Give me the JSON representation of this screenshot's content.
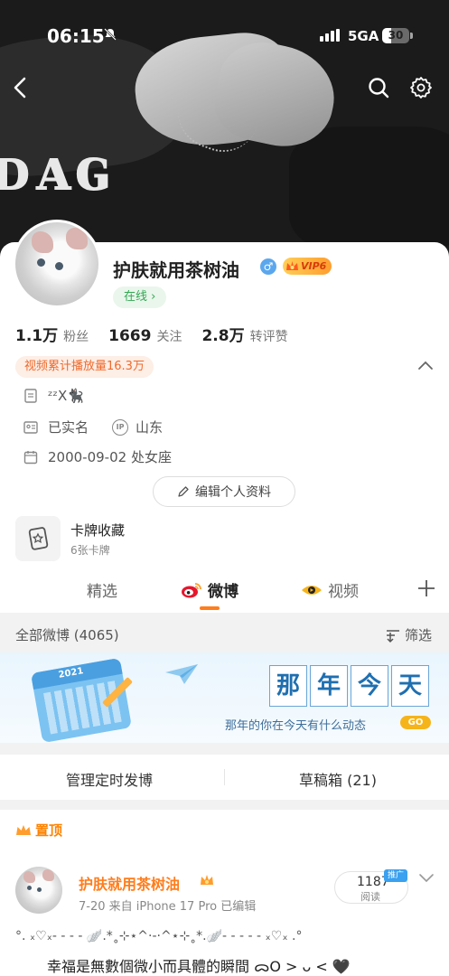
{
  "status_bar": {
    "time": "06:15",
    "network": "5GA",
    "battery": "30"
  },
  "cover": {
    "text": "ᴅᴀɢ"
  },
  "profile": {
    "username": "护肤就用茶树油",
    "gender_symbol": "♂",
    "vip_label": "VIP6",
    "online_label": "在线 ›",
    "stats": [
      {
        "value": "1.1万",
        "label": "粉丝"
      },
      {
        "value": "1669",
        "label": "关注"
      },
      {
        "value": "2.8万",
        "label": "转评赞"
      }
    ],
    "video_views": "视频累计播放量16.3万",
    "bio": "ᶻᶻX🐈‍⬛",
    "verified": "已实名",
    "ip_label": "IP",
    "location": "山东",
    "birthday": "2000-09-02 处女座",
    "edit_button": "编辑个人资料",
    "card_title": "卡牌收藏",
    "card_sub": "6张卡牌"
  },
  "tabs": [
    "精选",
    "微博",
    "视频"
  ],
  "filter": {
    "all_label": "全部微博 (4065)",
    "filter_label": "筛选"
  },
  "banner": {
    "year": "2021",
    "chars": [
      "那",
      "年",
      "今",
      "天"
    ],
    "subtitle": "那年的你在今天有什么动态",
    "go": "GO"
  },
  "manage": {
    "scheduled": "管理定时发博",
    "drafts": "草稿箱 (21)"
  },
  "post": {
    "pinned": "置顶",
    "author": "护肤就用茶树油",
    "meta": "7-20  来自 iPhone 17 Pro  已编辑",
    "reads": "1187",
    "reads_label": "阅读",
    "promo": "推广",
    "line1": "°. ₓ♡ₓ- - - - 🪽.*˳⊹⋆^·-·^⋆⊹˳*.🪽- - - - - ₓ♡ₓ .°",
    "line2": "幸福是無數個微小而具體的瞬間 ᯅO > ᴗ < 🖤"
  },
  "colors": {
    "accent": "#ff7d1d",
    "online_green": "#32a852",
    "link_blue": "#1f6fb0"
  }
}
